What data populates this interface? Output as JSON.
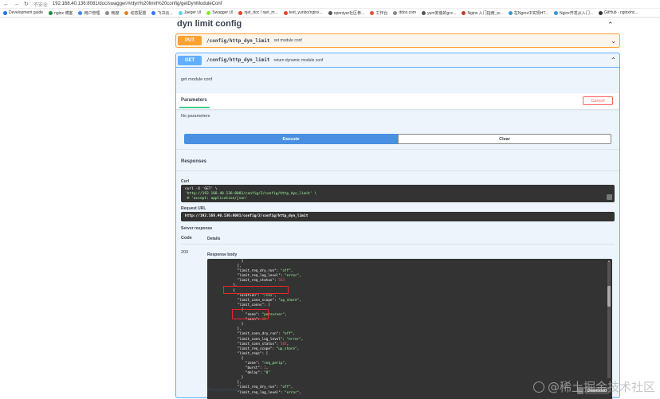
{
  "browser": {
    "security_label": "不安全",
    "url": "192.168.40.136:8081/doc/swagger/#/dyn%20limit%20config/getDynModuleConf"
  },
  "bookmarks": [
    {
      "label": "Development guide",
      "color": "#1a73e8"
    },
    {
      "label": "nginx 博客",
      "color": "#1f8a3a"
    },
    {
      "label": "用户管理",
      "color": "#4285f4"
    },
    {
      "label": "韩度",
      "color": "#888"
    },
    {
      "label": "动态配置",
      "color": "#e67e22"
    },
    {
      "label": "飞书云...",
      "color": "#3370ff"
    },
    {
      "label": "Jaeger UI",
      "color": "#60d0e4"
    },
    {
      "label": "Swagger UI",
      "color": "#85ea2d"
    },
    {
      "label": "njet_doc / njet_m...",
      "color": "#e24329"
    },
    {
      "label": "test_yunbo/nginx...",
      "color": "#e24329"
    },
    {
      "label": "opentyer社区参...",
      "color": "#555"
    },
    {
      "label": "工作台",
      "color": "#e74c3c"
    },
    {
      "label": "ddos.com",
      "color": "#888"
    },
    {
      "label": "yum安装的gcc...",
      "color": "#555"
    },
    {
      "label": "Nginx 入门指南_w...",
      "color": "#c0392b"
    },
    {
      "label": "在Nginx中实现HT...",
      "color": "#3498db"
    },
    {
      "label": "Nginx开发从入门...",
      "color": "#3498db"
    },
    {
      "label": "GitHub - nginxinc...",
      "color": "#333"
    }
  ],
  "section": {
    "title": "dyn limit config"
  },
  "put_op": {
    "method": "PUT",
    "path": "/config/http_dyn_limit",
    "summary": "set module conf"
  },
  "get_op": {
    "method": "GET",
    "path": "/config/http_dyn_limit",
    "summary": "return dynamic module conf",
    "description": "get module conf"
  },
  "parameters": {
    "title": "Parameters",
    "cancel_label": "Cancel",
    "empty_text": "No parameters"
  },
  "actions": {
    "execute_label": "Execute",
    "clear_label": "Clear"
  },
  "responses": {
    "title": "Responses",
    "curl_label": "Curl",
    "curl_lines": [
      "curl -X 'GET' \\",
      "  'http://192.168.40.136:8081/config/2/config/http_dyn_limit' \\",
      "  -H 'accept: application/json'"
    ],
    "request_url_label": "Request URL",
    "request_url": "http://192.168.40.136:8081/config/2/config/http_dyn_limit",
    "server_response_label": "Server response",
    "code_header": "Code",
    "details_header": "Details",
    "code_value": "200",
    "response_body_label": "Response body",
    "body_lines": [
      "        }",
      "      ],",
      "      \"limit_req_dry_run\": \"off\",",
      "      \"limit_req_log_level\": \"error\",",
      "      \"limit_req_status\": 503",
      "    },",
      "    {",
      "      \"location\": \"/ch2\",",
      "      \"limit_conn_scope\": \"up_share\",",
      "      \"limit_conns\": [",
      "        {",
      "          \"zone\": \"perserver\",",
      "          \"conn\": 10",
      "        }",
      "      ],",
      "      \"limit_conn_dry_run\": \"off\",",
      "      \"limit_conn_log_level\": \"error\",",
      "      \"limit_conn_status\": 503,",
      "      \"limit_req_scope\": \"up_share\",",
      "      \"limit_reqs\": [",
      "        {",
      "          \"zone\": \"req_perip\",",
      "          \"burst\": 2,",
      "          \"delay\": \"0\"",
      "        }",
      "      ],",
      "      \"limit_req_dry_run\": \"off\",",
      "      \"limit_req_log_level\": \"error\",",
      "      \"limit_req_status\": 503"
    ],
    "download_label": "Download",
    "response_headers_label": "Response headers"
  },
  "watermark": {
    "text": "@稀土掘金技术社区"
  }
}
